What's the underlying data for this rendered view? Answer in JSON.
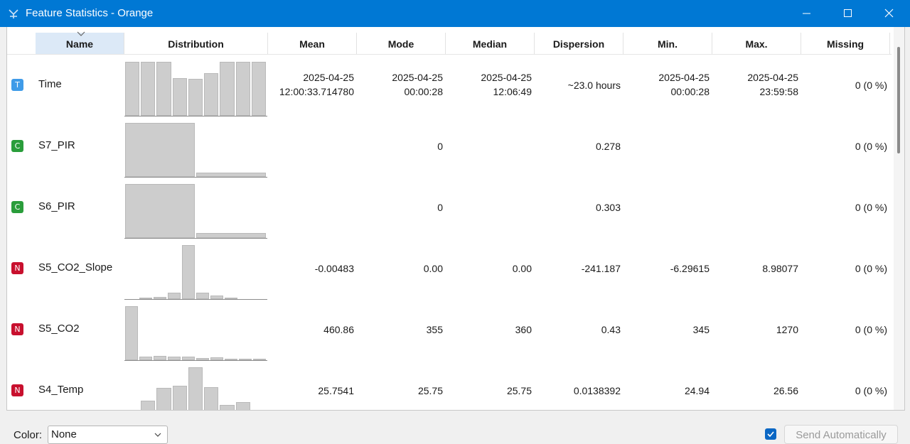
{
  "window": {
    "title": "Feature Statistics - Orange",
    "icon": "orange-app-icon"
  },
  "columns": [
    "Name",
    "Distribution",
    "Mean",
    "Mode",
    "Median",
    "Dispersion",
    "Min.",
    "Max.",
    "Missing"
  ],
  "sort": {
    "column": "Name",
    "indicator": "chevron-down-icon"
  },
  "colors": {
    "titlebar": "#0078d4",
    "type_time": "#3f9be8",
    "type_categorical": "#2a9d3b",
    "type_numeric": "#c8102e",
    "accent": "#0b67c4"
  },
  "rows": [
    {
      "type": "T",
      "name": "Time",
      "mean": [
        "2025-04-25",
        "12:00:33.714780"
      ],
      "mode": [
        "2025-04-25",
        "00:00:28"
      ],
      "median": [
        "2025-04-25",
        "12:06:49"
      ],
      "dispersion": [
        "~23.0 hours"
      ],
      "min": [
        "2025-04-25",
        "00:00:28"
      ],
      "max": [
        "2025-04-25",
        "23:59:58"
      ],
      "missing": "0 (0 %)",
      "distribution": [
        1.0,
        1.0,
        1.0,
        0.7,
        0.69,
        0.79,
        1.0,
        1.0,
        1.0
      ]
    },
    {
      "type": "C",
      "name": "S7_PIR",
      "mean": [],
      "mode": [
        "0"
      ],
      "median": [],
      "dispersion": [
        "0.278"
      ],
      "min": [],
      "max": [],
      "missing": "0 (0 %)",
      "distribution": [
        1.0,
        0.08
      ]
    },
    {
      "type": "C",
      "name": "S6_PIR",
      "mean": [],
      "mode": [
        "0"
      ],
      "median": [],
      "dispersion": [
        "0.303"
      ],
      "min": [],
      "max": [],
      "missing": "0 (0 %)",
      "distribution": [
        1.0,
        0.09
      ]
    },
    {
      "type": "N",
      "name": "S5_CO2_Slope",
      "mean": [
        "-0.00483"
      ],
      "mode": [
        "0.00"
      ],
      "median": [
        "0.00"
      ],
      "dispersion": [
        "-241.187"
      ],
      "min": [
        "-6.29615"
      ],
      "max": [
        "8.98077"
      ],
      "missing": "0 (0 %)",
      "distribution": [
        0.0,
        0.02,
        0.04,
        0.12,
        1.0,
        0.12,
        0.06,
        0.01,
        0.0,
        0.0
      ]
    },
    {
      "type": "N",
      "name": "S5_CO2",
      "mean": [
        "460.86"
      ],
      "mode": [
        "355"
      ],
      "median": [
        "360"
      ],
      "dispersion": [
        "0.43"
      ],
      "min": [
        "345"
      ],
      "max": [
        "1270"
      ],
      "missing": "0 (0 %)",
      "distribution": [
        1.0,
        0.07,
        0.08,
        0.06,
        0.06,
        0.04,
        0.05,
        0.02,
        0.02,
        0.02
      ]
    },
    {
      "type": "N",
      "name": "S4_Temp",
      "mean": [
        "25.7541"
      ],
      "mode": [
        "25.75"
      ],
      "median": [
        "25.75"
      ],
      "dispersion": [
        "0.0138392"
      ],
      "min": [
        "24.94"
      ],
      "max": [
        "26.56"
      ],
      "missing": "0 (0 %)",
      "distribution": [
        0.0,
        0.38,
        0.62,
        0.66,
        1.0,
        0.63,
        0.3,
        0.36,
        0.07
      ]
    }
  ],
  "footer": {
    "color_label": "Color:",
    "color_value": "None",
    "send_auto_checked": true,
    "send_button": "Send Automatically"
  }
}
